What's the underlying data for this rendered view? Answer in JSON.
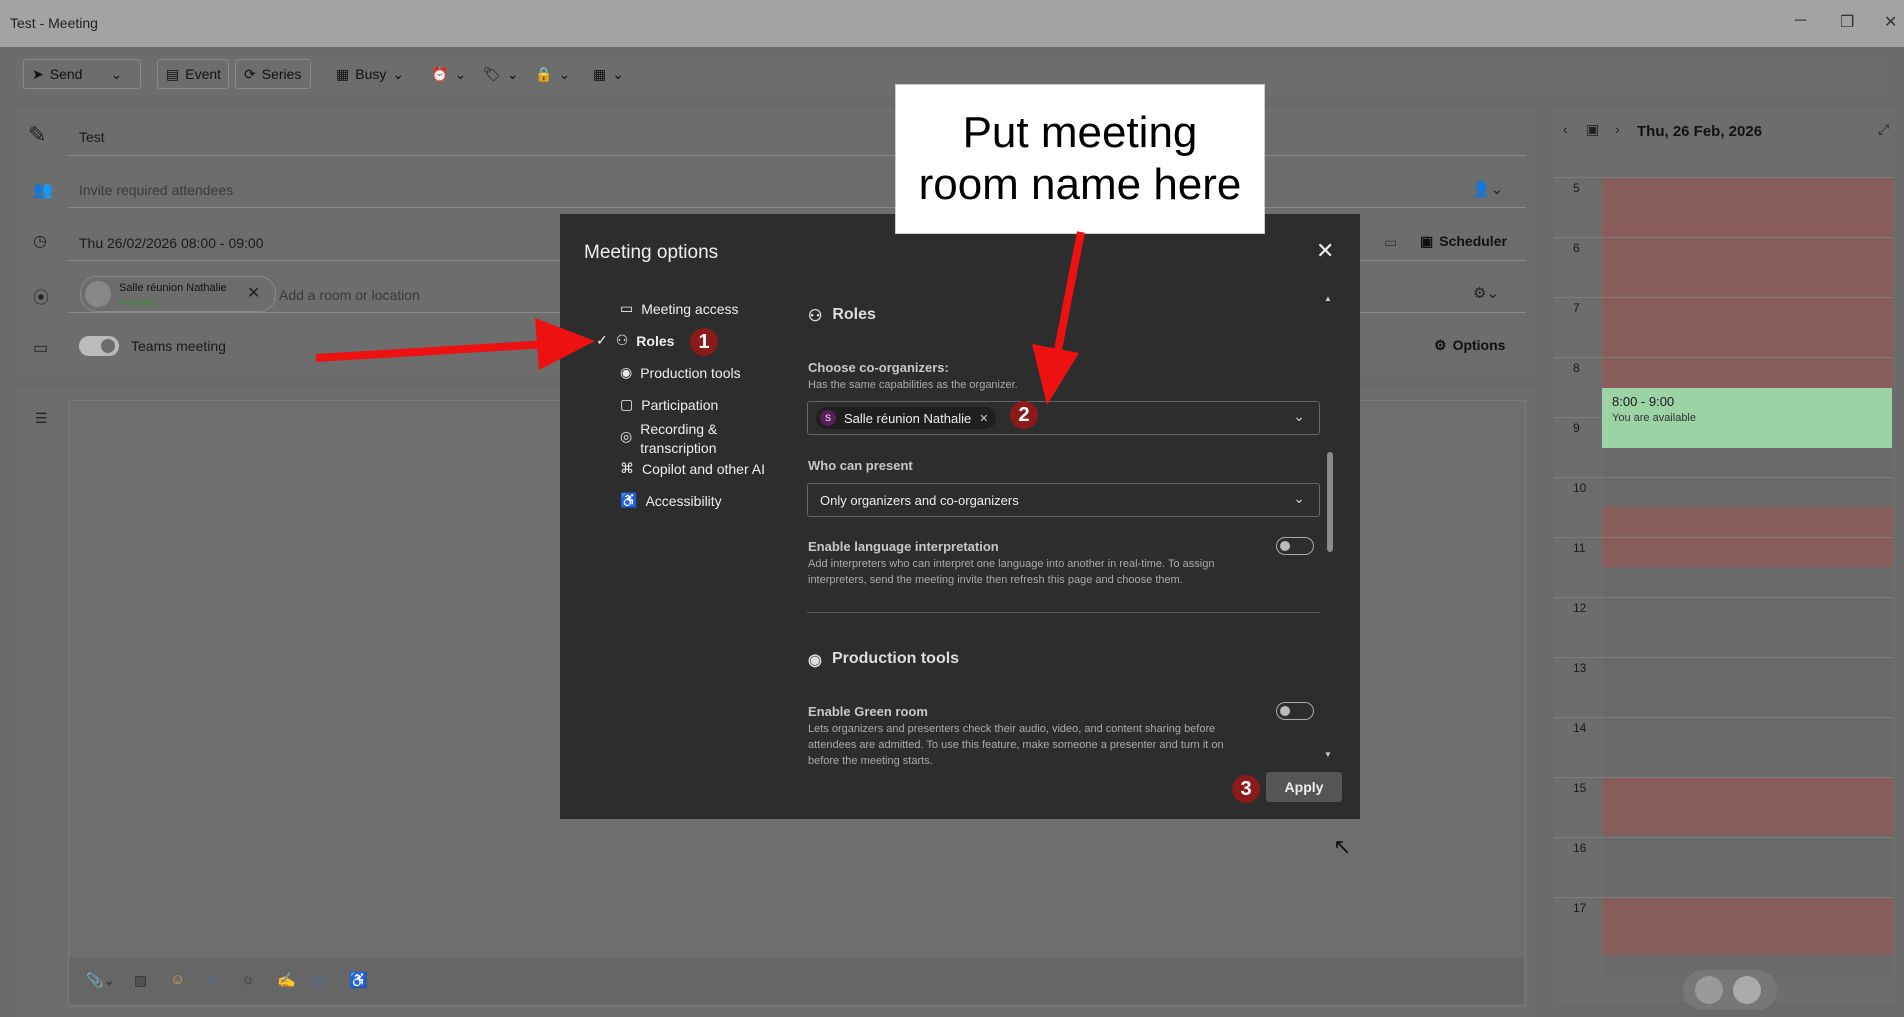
{
  "window": {
    "title": "Test - Meeting"
  },
  "toolbar": {
    "send": "Send",
    "event": "Event",
    "series": "Series",
    "busy": "Busy"
  },
  "form": {
    "subject": "Test",
    "attendees_placeholder": "Invite required attendees",
    "datetime": "Thu 26/02/2026 08:00 - 09:00",
    "scheduler": "Scheduler",
    "room_chip": "Salle réunion Nathalie",
    "room_status": "Available",
    "location_placeholder": "Add a room or location",
    "teams_meeting": "Teams meeting",
    "options": "Options"
  },
  "calendar": {
    "date": "Thu, 26 Feb, 2026",
    "hours": [
      "5",
      "6",
      "7",
      "8",
      "9",
      "10",
      "11",
      "12",
      "13",
      "14",
      "15",
      "16",
      "17"
    ],
    "event_time": "8:00 - 9:00",
    "event_status": "You are available"
  },
  "dialog": {
    "title": "Meeting options",
    "nav": [
      "Meeting access",
      "Roles",
      "Production tools",
      "Participation",
      "Recording &",
      "transcription",
      "Copilot and other AI",
      "Accessibility"
    ],
    "roles_heading": "Roles",
    "coorg_label": "Choose co-organizers:",
    "coorg_desc": "Has the same capabilities as the organizer.",
    "coorg_chip": "Salle réunion Nathalie",
    "coorg_chip_initial": "S",
    "present_label": "Who can present",
    "present_value": "Only organizers and co-organizers",
    "lang_label": "Enable language interpretation",
    "lang_desc1": "Add interpreters who can interpret one language into another in real-time. To assign",
    "lang_desc2": "interpreters, send the meeting invite then refresh this page and choose them.",
    "prod_heading": "Production tools",
    "green_label": "Enable Green room",
    "green_desc1": "Lets organizers and presenters check their audio, video, and content sharing before",
    "green_desc2": "attendees are admitted. To use this feature, make someone a presenter and turn it on",
    "green_desc3": "before the meeting starts.",
    "apply": "Apply"
  },
  "annotations": {
    "callout1": "Put meeting",
    "callout2": "room name here",
    "badge1": "1",
    "badge2": "2",
    "badge3": "3"
  },
  "colors": {
    "arrow": "#ee1111",
    "badge": "#8b1a1a",
    "event": "#9bd3a5",
    "busy_slot": "#8a5d5d"
  }
}
